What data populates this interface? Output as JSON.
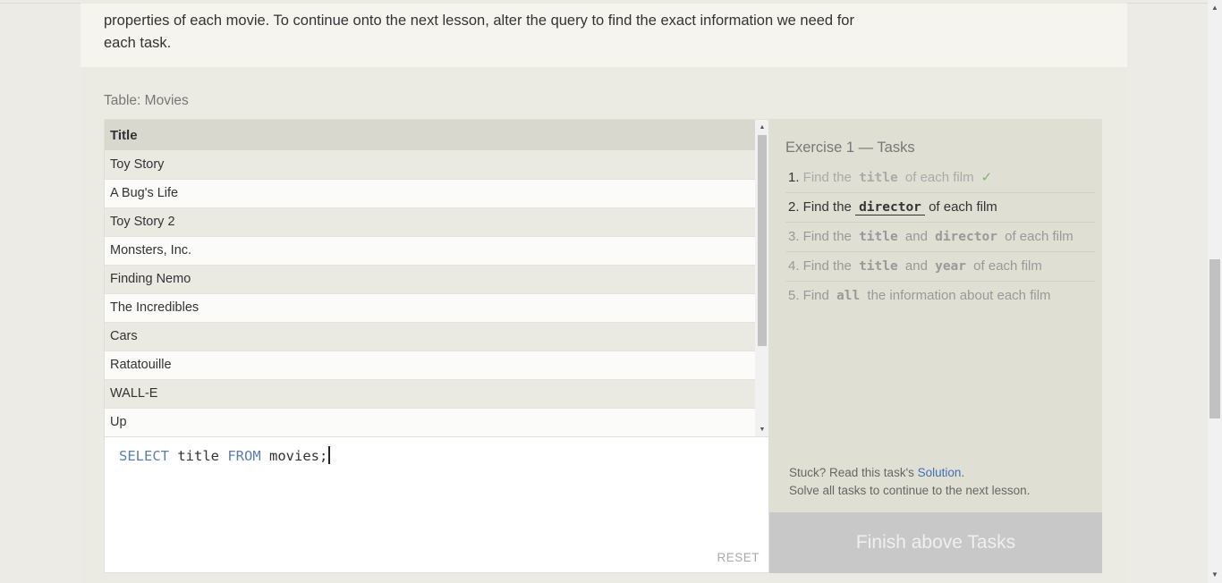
{
  "intro": {
    "text": "properties of each movie. To continue onto the next lesson, alter the query to find the exact information we need for each task."
  },
  "table": {
    "label": "Table: Movies",
    "header": "Title",
    "rows": [
      "Toy Story",
      "A Bug's Life",
      "Toy Story 2",
      "Monsters, Inc.",
      "Finding Nemo",
      "The Incredibles",
      "Cars",
      "Ratatouille",
      "WALL-E",
      "Up"
    ]
  },
  "editor": {
    "kw1": "SELECT",
    "t1": " title ",
    "kw2": "FROM",
    "t2": " movies;",
    "reset_label": "RESET"
  },
  "tasks": {
    "title": "Exercise 1 — Tasks",
    "items": [
      {
        "num": "1.",
        "pre": " Find the ",
        "code": "title",
        "post": " of each film",
        "check": "✓"
      },
      {
        "num": "2.",
        "pre": " Find the ",
        "code": "director",
        "post": " of each film"
      },
      {
        "num": "3.",
        "pre": " Find the ",
        "code": "title",
        "mid": " and ",
        "code2": "director",
        "post": " of each film"
      },
      {
        "num": "4.",
        "pre": " Find the ",
        "code": "title",
        "mid": " and ",
        "code2": "year",
        "post": " of each film"
      },
      {
        "num": "5.",
        "pre": " Find ",
        "code": "all",
        "post": " the information about each film"
      }
    ],
    "stuck_text": "Stuck? Read this task's ",
    "solution_link": "Solution",
    "stuck_dot": ".",
    "solve_text": "Solve all tasks to continue to the next lesson.",
    "finish_label": "Finish above Tasks"
  },
  "icons": {
    "scroll_up": "▲",
    "scroll_down": "▼"
  }
}
